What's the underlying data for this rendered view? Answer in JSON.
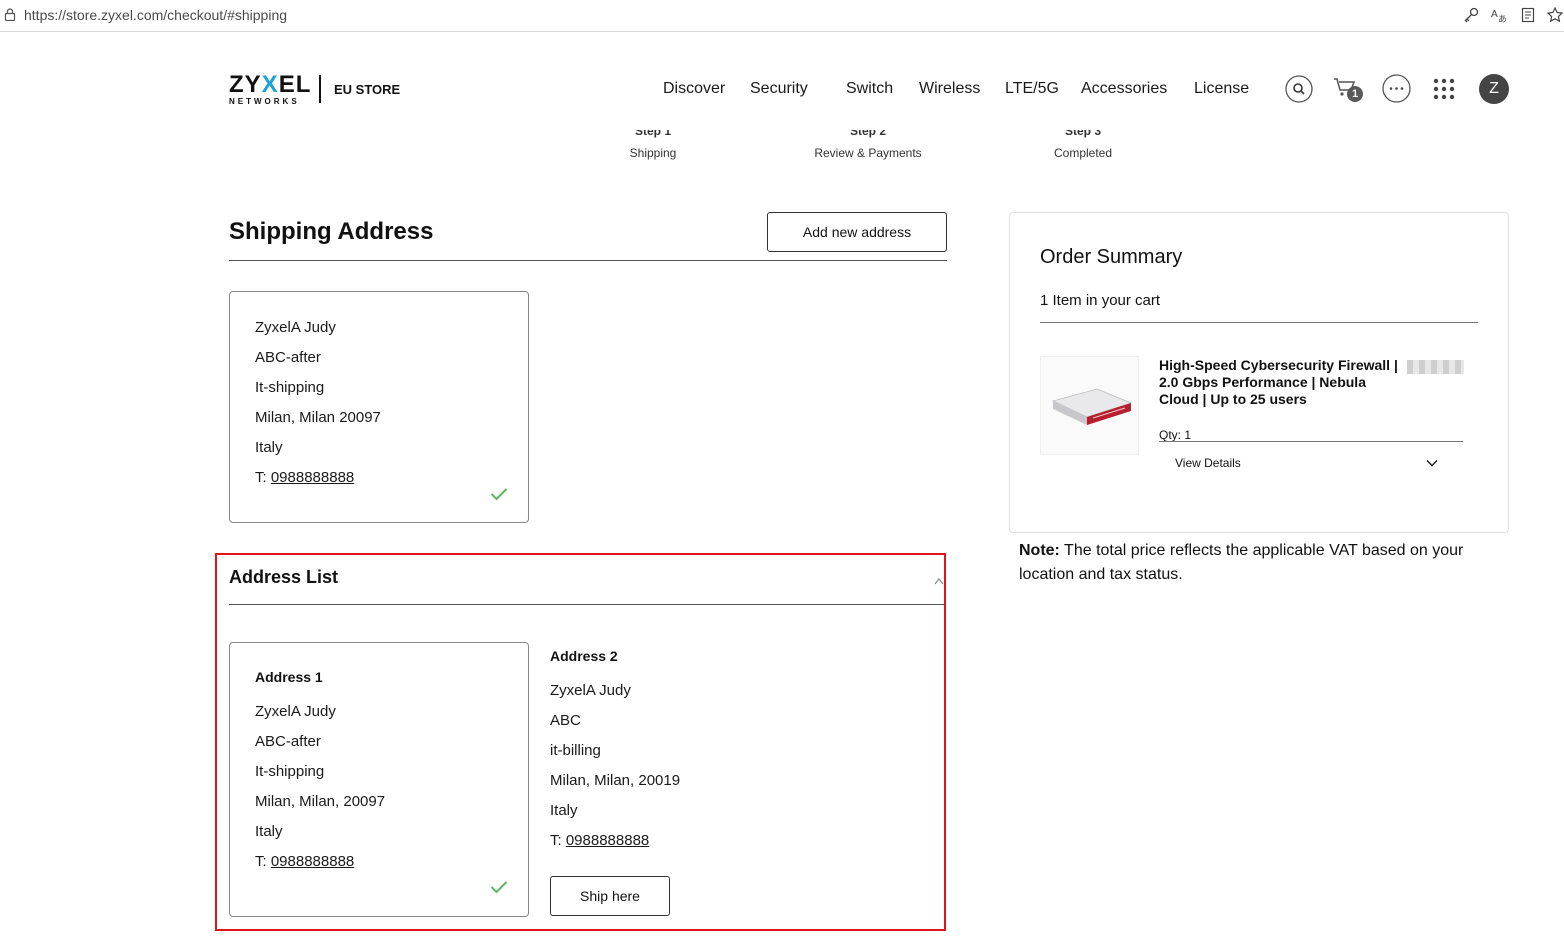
{
  "browser": {
    "url": "https://store.zyxel.com/checkout/#shipping"
  },
  "header": {
    "logo_main_pre": "ZY",
    "logo_main_x": "X",
    "logo_main_post": "EL",
    "logo_sub": "NETWORKS",
    "store_label": "EU STORE",
    "nav": [
      "Discover",
      "Security",
      "Switch",
      "Wireless",
      "LTE/5G",
      "Accessories",
      "License"
    ],
    "cart_count": "1",
    "avatar_letter": "Z"
  },
  "steps": [
    {
      "num": "Step 1",
      "label": "Shipping"
    },
    {
      "num": "Step 2",
      "label": "Review & Payments"
    },
    {
      "num": "Step 3",
      "label": "Completed"
    }
  ],
  "shipping": {
    "title": "Shipping Address",
    "add_button": "Add new address",
    "selected": {
      "name": "ZyxelA Judy",
      "company": "ABC-after",
      "street": "It-shipping",
      "city": "Milan, Milan 20097",
      "country": "Italy",
      "phone_prefix": "T: ",
      "phone": "0988888888"
    }
  },
  "address_list": {
    "title": "Address List",
    "addresses": [
      {
        "title": "Address 1",
        "name": "ZyxelA Judy",
        "company": "ABC-after",
        "street": "It-shipping",
        "city": "Milan, Milan, 20097",
        "country": "Italy",
        "phone_prefix": "T: ",
        "phone": "0988888888"
      },
      {
        "title": "Address 2",
        "name": "ZyxelA Judy",
        "company": "ABC",
        "street": "it-billing",
        "city": "Milan, Milan, 20019",
        "country": "Italy",
        "phone_prefix": "T: ",
        "phone": "0988888888",
        "button": "Ship here"
      }
    ]
  },
  "summary": {
    "title": "Order Summary",
    "count": "1 Item in your cart",
    "product_name": "High-Speed Cybersecurity Firewall | 2.0 Gbps Performance | Nebula Cloud | Up to 25 users",
    "qty": "Qty: 1",
    "view_details": "View Details"
  },
  "note": {
    "label": "Note:",
    "text": " The total price reflects the applicable VAT based on your location and tax status."
  },
  "colors": {
    "logo_accent": "#1aa1d8",
    "check_green": "#5cb85c",
    "highlight_red": "#e3131b"
  }
}
